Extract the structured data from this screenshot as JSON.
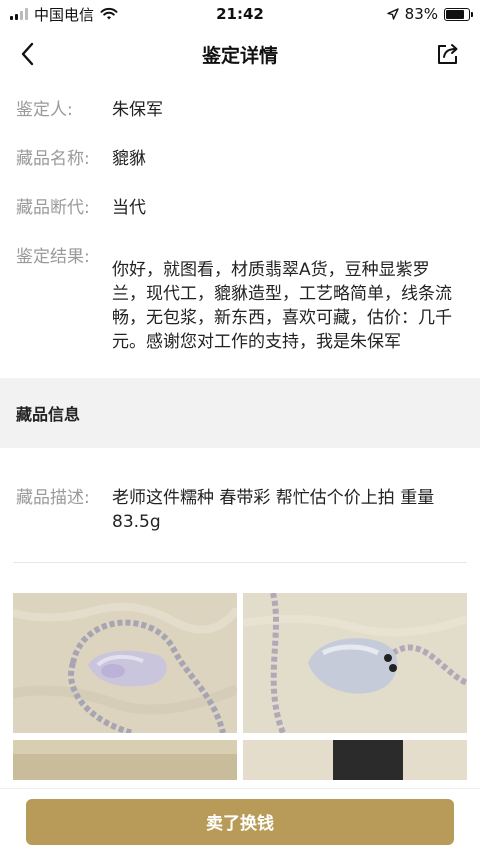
{
  "status_bar": {
    "carrier": "中国电信",
    "time": "21:42",
    "battery": "83%",
    "battery_level": 0.83
  },
  "nav": {
    "title": "鉴定详情",
    "back_icon": "chevron-left-icon",
    "share_icon": "share-icon"
  },
  "appraisal": {
    "appraiser_label": "鉴定人:",
    "appraiser_value": "朱保军",
    "item_name_label": "藏品名称:",
    "item_name_value": "貔貅",
    "era_label": "藏品断代:",
    "era_value": "当代",
    "result_label": "鉴定结果:",
    "result_value": "你好，就图看，材质翡翠A货，豆种显紫罗兰，现代工，貔貅造型，工艺略简单，线条流畅，无包浆，新东西，喜欢可藏，估价：几千元。感谢您对工作的支持，我是朱保军"
  },
  "collection_info": {
    "section_title": "藏品信息",
    "desc_label": "藏品描述:",
    "desc_value": "老师这件糯种 春带彩 帮忙估个价上拍 重量83.5g"
  },
  "photos": {
    "count_visible": 4
  },
  "bottom": {
    "sell_button_label": "卖了换钱",
    "accent_color": "#b89b58"
  }
}
